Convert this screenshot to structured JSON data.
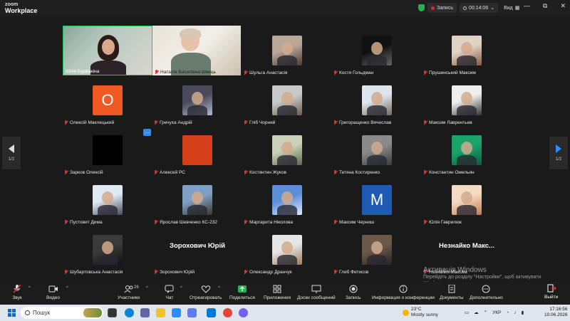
{
  "app": {
    "logo_top": "zoom",
    "logo_bottom": "Workplace",
    "recording_label": "Запись",
    "timer": "00:14:06",
    "view_label": "Вид",
    "win_min": "—",
    "win_max": "⧉",
    "win_close": "✕"
  },
  "colors": {
    "accent": "#2d8cff",
    "active_speaker": "#22c55e",
    "mic_muted": "#dd3333",
    "record": "#e02828"
  },
  "pager": {
    "left_label": "1/2",
    "right_label": "1/2"
  },
  "video_tiles": [
    {
      "name": "Юлія Бурмакіна",
      "active": true
    },
    {
      "name": "Наталія Василівна Швець",
      "active": false
    }
  ],
  "participants": [
    {
      "name": "Шульга Анастасія"
    },
    {
      "name": "Костя Гольдман"
    },
    {
      "name": "Прушинський Максим"
    },
    {
      "name": "Олексій Маклецький",
      "letter": "O",
      "color": "#f05a22"
    },
    {
      "name": "Гречуха Андрій"
    },
    {
      "name": "Гліб Чорний"
    },
    {
      "name": "Григоращенко Вячеслав"
    },
    {
      "name": "Максим Лаврентьев"
    },
    {
      "name": "Зарков Олексій",
      "color": "#000000"
    },
    {
      "name": "Алексей РС",
      "color": "#d5401a"
    },
    {
      "name": "Костянтин Жуков"
    },
    {
      "name": "Тетяна Костиренко"
    },
    {
      "name": "Константин Омельян"
    },
    {
      "name": "Пустовит Дима"
    },
    {
      "name": "Ярослав Шевченко КС-232"
    },
    {
      "name": "Маргарита Ніколова"
    },
    {
      "name": "Максим Черниш",
      "letter": "M",
      "color": "#1f5bb5"
    },
    {
      "name": "Юлія Гаврилюк"
    },
    {
      "name": "Шубартовська Анастасія"
    },
    {
      "name": "Зорохович Юрій",
      "bigname": "Зорохович Юрій"
    },
    {
      "name": "Олександр Дранчук"
    },
    {
      "name": "Глеб Фетисов"
    },
    {
      "name": "Незнайко Максим",
      "bigname": "Незнайко Макс..."
    }
  ],
  "small_chat_icon": "chat-bubble",
  "activation": {
    "title": "Активація Windows",
    "subtitle": "Перейдіть до розділу \"Настройки\", щоб активувати Windows."
  },
  "toolbar": {
    "audio": "Звук",
    "video": "Видео",
    "participants": "Участники",
    "participants_count": "26",
    "chat": "Чат",
    "react": "Отреагировать",
    "share": "Поделиться",
    "apps": "Приложения",
    "whiteboards": "Доски сообщений",
    "record": "Запись",
    "info": "Информация о конференции",
    "docs": "Документы",
    "more": "Дополнительно",
    "leave": "Выйти"
  },
  "taskbar": {
    "search_placeholder": "Пошук",
    "weather_temp": "23°C",
    "weather_desc": "Mostly sunny",
    "lang": "УКР",
    "time": "17:16:56",
    "date": "10.06.2026"
  }
}
